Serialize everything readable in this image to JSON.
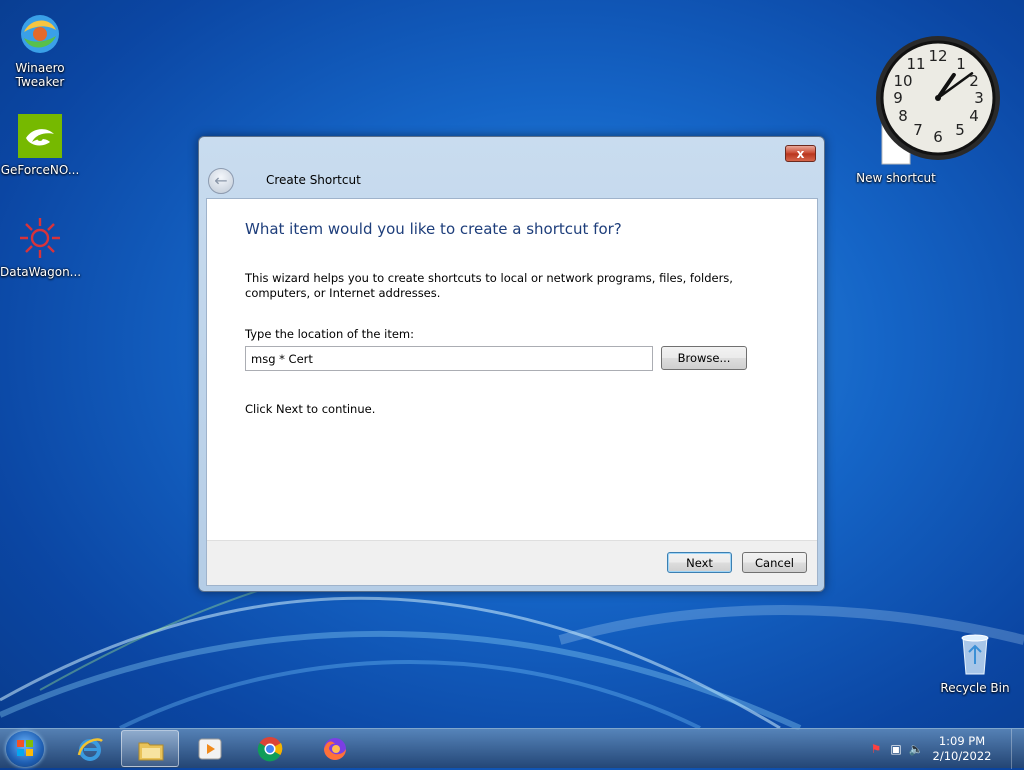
{
  "desktop": {
    "icons": [
      {
        "label": "Winaero Tweaker"
      },
      {
        "label": "GeForceNO..."
      },
      {
        "label": "DataWagon..."
      },
      {
        "label": "New shortcut"
      },
      {
        "label": "Recycle Bin"
      }
    ]
  },
  "dialog": {
    "title": "Create Shortcut",
    "close_label": "x",
    "heading": "What item would you like to create a shortcut for?",
    "description": "This wizard helps you to create shortcuts to local or network programs, files, folders, computers, or Internet addresses.",
    "location_label": "Type the location of the item:",
    "location_value": "msg * Cert",
    "browse_label": "Browse...",
    "continue_text": "Click Next to continue.",
    "next_label": "Next",
    "cancel_label": "Cancel"
  },
  "taskbar": {
    "time": "1:09 PM",
    "date": "2/10/2022",
    "items": [
      "internet-explorer",
      "file-explorer",
      "media-player",
      "chrome",
      "firefox"
    ]
  },
  "gadget_clock": {
    "hour": 1,
    "minute": 9
  },
  "colors": {
    "accent": "#1e3e7b",
    "close": "#c8442b"
  }
}
